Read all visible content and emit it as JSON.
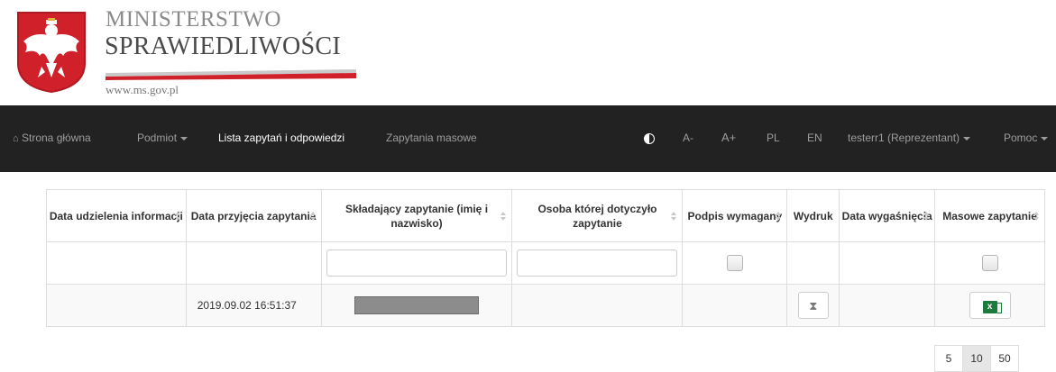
{
  "header": {
    "ministry_top": "MINISTERSTWO",
    "ministry_main": "SPRAWIEDLIWOŚCI",
    "url": "www.ms.gov.pl"
  },
  "nav": {
    "home": "Strona główna",
    "podmiot": "Podmiot",
    "lista": "Lista zapytań i odpowiedzi",
    "masowe": "Zapytania masowe",
    "font_smaller": "A-",
    "font_larger": "A+",
    "lang_pl": "PL",
    "lang_en": "EN",
    "user": "testerr1 (Reprezentant)",
    "help": "Pomoc"
  },
  "table": {
    "headers": [
      "Data udzielenia informacji",
      "Data przyjęcia zapytania",
      "Składający zapytanie (imię i nazwisko)",
      "Osoba której dotyczyło zapytanie",
      "Podpis wymagany",
      "Wydruk",
      "Data wygaśnięcia",
      "Masowe zapytanie"
    ],
    "rows": [
      {
        "data_przyjecia": "2019.09.02 16:51:37"
      }
    ]
  },
  "pagination": {
    "sizes": [
      "5",
      "10",
      "50"
    ],
    "active": "10"
  },
  "colors": {
    "navbar": "#222222",
    "excel": "#1d7a3d"
  }
}
